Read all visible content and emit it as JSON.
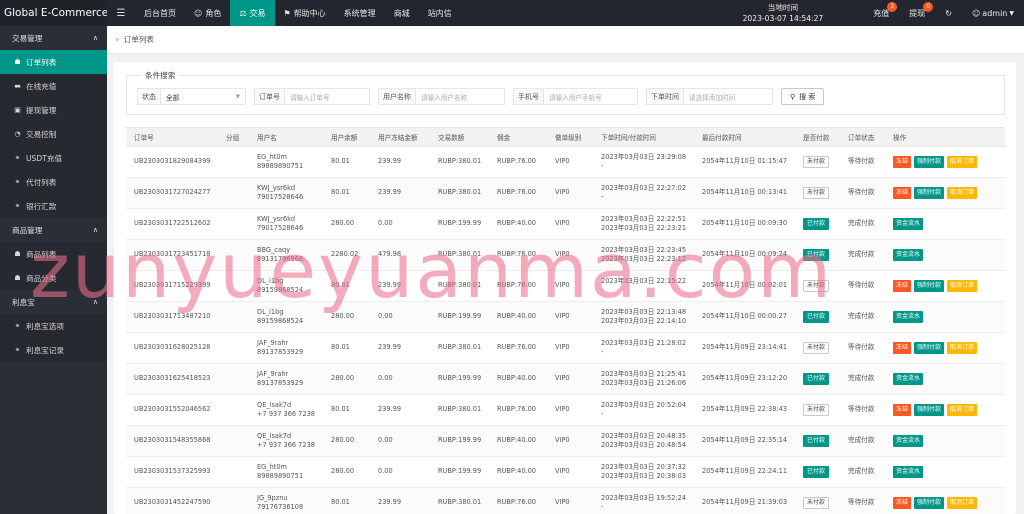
{
  "app": {
    "title": "Global E-Commerce..."
  },
  "topnav": [
    {
      "label": "后台首页",
      "icon": "home-icon",
      "active": false
    },
    {
      "label": "角色",
      "icon": "user-icon",
      "active": false
    },
    {
      "label": "交易",
      "icon": "scale-icon",
      "active": true
    },
    {
      "label": "帮助中心",
      "icon": "flag-icon",
      "active": false
    },
    {
      "label": "系统管理",
      "icon": "",
      "active": false
    },
    {
      "label": "商城",
      "icon": "",
      "active": false
    },
    {
      "label": "站内信",
      "icon": "",
      "active": false
    }
  ],
  "clock": {
    "label": "当地时间",
    "value": "2023-03-07 14:54:27"
  },
  "topright": {
    "recharge": {
      "label": "充值",
      "badge": "2"
    },
    "withdraw": {
      "label": "提现",
      "badge": "0"
    },
    "user": "admin"
  },
  "sidebar": {
    "group1": "交易管理",
    "group1_items": [
      {
        "label": "订单列表",
        "icon": "cart-icon",
        "active": true
      },
      {
        "label": "在线充值",
        "icon": "card-icon",
        "active": false
      },
      {
        "label": "提现管理",
        "icon": "wallet-icon",
        "active": false
      },
      {
        "label": "交易控制",
        "icon": "gauge-icon",
        "active": false
      },
      {
        "label": "USDT充值",
        "icon": "link-icon",
        "active": false
      },
      {
        "label": "代付列表",
        "icon": "link-icon",
        "active": false
      },
      {
        "label": "银行汇款",
        "icon": "link-icon",
        "active": false
      }
    ],
    "group2": "商品管理",
    "group2_items": [
      {
        "label": "商品列表",
        "icon": "cart-icon",
        "active": false
      },
      {
        "label": "商品分类",
        "icon": "cart-icon",
        "active": false
      }
    ],
    "group3": "利息宝",
    "group3_items": [
      {
        "label": "利息宝选项",
        "icon": "link-icon",
        "active": false
      },
      {
        "label": "利息宝记录",
        "icon": "link-icon",
        "active": false
      }
    ]
  },
  "breadcrumb": "订单列表",
  "filters": {
    "legend": "条件搜索",
    "status_label": "状态",
    "status_value": "全部",
    "order_label": "订单号",
    "order_placeholder": "请输入订单号",
    "username_label": "用户名称",
    "username_placeholder": "请输入用户名称",
    "phone_label": "手机号",
    "phone_placeholder": "请输入用户手机号",
    "time_label": "下单时间",
    "time_placeholder": "请选择添加时间",
    "search_button": "搜 索"
  },
  "table": {
    "headers": [
      "订单号",
      "分组",
      "用户名",
      "用户余额",
      "用户冻结金额",
      "交易数额",
      "佣金",
      "做单级别",
      "下单时间/付款时间",
      "最后付款时间",
      "是否付款",
      "订单状态",
      "操作"
    ],
    "rows": [
      {
        "order": "UB2303031829084399",
        "group": "",
        "user": "EG_ht0m",
        "phone": "89889890751",
        "balance": "80.01",
        "frozen": "239.99",
        "amount": "RUBP:380.01",
        "commission": "RUBP:76.00",
        "level": "VIP0",
        "t1": "2023年03月03日 23:29:08",
        "t2": "-",
        "last": "2054年11月10日 01:15:47",
        "pay": "未付款",
        "paid": false,
        "status": "等待付款"
      },
      {
        "order": "UB2303031727024277",
        "group": "",
        "user": "KWJ_ysr6kd",
        "phone": "79017528646",
        "balance": "80.01",
        "frozen": "239.99",
        "amount": "RUBP:380.01",
        "commission": "RUBP:76.00",
        "level": "VIP0",
        "t1": "2023年03月03日 22:27:02",
        "t2": "-",
        "last": "2054年11月10日 00:13:41",
        "pay": "未付款",
        "paid": false,
        "status": "等待付款"
      },
      {
        "order": "UB2303031722512602",
        "group": "",
        "user": "KWJ_ysr6kd",
        "phone": "79017528646",
        "balance": "280.00",
        "frozen": "0.00",
        "amount": "RUBP:199.99",
        "commission": "RUBP:40.00",
        "level": "VIP0",
        "t1": "2023年03月03日 22:22:51",
        "t2": "2023年03月03日 22:23:21",
        "last": "2054年11月10日 00:09:30",
        "pay": "已付款",
        "paid": true,
        "status": "完成付款"
      },
      {
        "order": "UB2303031723451718",
        "group": "",
        "user": "BBG_caqy",
        "phone": "89131796966",
        "balance": "2280.02",
        "frozen": "479.98",
        "amount": "RUBP:380.01",
        "commission": "RUBP:76.00",
        "level": "VIP0",
        "t1": "2023年03月03日 22:23:45",
        "t2": "2023年03月03日 22:23:12",
        "last": "2054年11月10日 00:09:24",
        "pay": "已付款",
        "paid": true,
        "status": "完成付款"
      },
      {
        "order": "UB2303031715229399",
        "group": "",
        "user": "DL_i1bg",
        "phone": "89159868524",
        "balance": "80.01",
        "frozen": "239.99",
        "amount": "RUBP:380.01",
        "commission": "RUBP:76.00",
        "level": "VIP0",
        "t1": "2023年03月03日 22:15:22",
        "t2": "-",
        "last": "2054年11月10日 00:02:01",
        "pay": "未付款",
        "paid": false,
        "status": "等待付款"
      },
      {
        "order": "UB2303031713487210",
        "group": "",
        "user": "DL_i1bg",
        "phone": "89159868524",
        "balance": "280.00",
        "frozen": "0.00",
        "amount": "RUBP:199.99",
        "commission": "RUBP:40.00",
        "level": "VIP0",
        "t1": "2023年03月03日 22:13:48",
        "t2": "2023年03月03日 22:14:10",
        "last": "2054年11月10日 00:00:27",
        "pay": "已付款",
        "paid": true,
        "status": "完成付款"
      },
      {
        "order": "UB2303031628025128",
        "group": "",
        "user": "JAF_9rahr",
        "phone": "89137853929",
        "balance": "80.01",
        "frozen": "239.99",
        "amount": "RUBP:380.01",
        "commission": "RUBP:76.00",
        "level": "VIP0",
        "t1": "2023年03月03日 21:28:02",
        "t2": "-",
        "last": "2054年11月09日 23:14:41",
        "pay": "未付款",
        "paid": false,
        "status": "等待付款"
      },
      {
        "order": "UB2303031625418523",
        "group": "",
        "user": "JAF_9rahr",
        "phone": "89137853929",
        "balance": "280.00",
        "frozen": "0.00",
        "amount": "RUBP:199.99",
        "commission": "RUBP:40.00",
        "level": "VIP0",
        "t1": "2023年03月03日 21:25:41",
        "t2": "2023年03月03日 21:26:06",
        "last": "2054年11月09日 23:12:20",
        "pay": "已付款",
        "paid": true,
        "status": "完成付款"
      },
      {
        "order": "UB2303031552046562",
        "group": "",
        "user": "QE_lsak7d",
        "phone": "+7 937 366 7238",
        "balance": "80.01",
        "frozen": "239.99",
        "amount": "RUBP:380.01",
        "commission": "RUBP:76.00",
        "level": "VIP0",
        "t1": "2023年03月03日 20:52:04",
        "t2": "-",
        "last": "2054年11月09日 22:38:43",
        "pay": "未付款",
        "paid": false,
        "status": "等待付款"
      },
      {
        "order": "UB2303031548355868",
        "group": "",
        "user": "QE_lsak7d",
        "phone": "+7 937 366 7238",
        "balance": "280.00",
        "frozen": "0.00",
        "amount": "RUBP:199.99",
        "commission": "RUBP:40.00",
        "level": "VIP0",
        "t1": "2023年03月03日 20:48:35",
        "t2": "2023年03月03日 20:48:54",
        "last": "2054年11月09日 22:35:14",
        "pay": "已付款",
        "paid": true,
        "status": "完成付款"
      },
      {
        "order": "UB2303031537325993",
        "group": "",
        "user": "EG_ht0m",
        "phone": "89889890751",
        "balance": "280.00",
        "frozen": "0.00",
        "amount": "RUBP:199.99",
        "commission": "RUBP:40.00",
        "level": "VIP0",
        "t1": "2023年03月03日 20:37:32",
        "t2": "2023年03月03日 20:38:03",
        "last": "2054年11月09日 22:24:11",
        "pay": "已付款",
        "paid": true,
        "status": "完成付款"
      },
      {
        "order": "UB2303031452247590",
        "group": "",
        "user": "JG_9pznu",
        "phone": "79176736108",
        "balance": "80.01",
        "frozen": "239.99",
        "amount": "RUBP:380.01",
        "commission": "RUBP:76.00",
        "level": "VIP0",
        "t1": "2023年03月03日 19:52:24",
        "t2": "-",
        "last": "2054年11月09日 21:39:03",
        "pay": "未付款",
        "paid": false,
        "status": "等待付款"
      }
    ],
    "actions_unpaid": [
      "冻结",
      "强制付款",
      "取消订单"
    ],
    "action_paid": "资金流水"
  },
  "watermark": "zunyueyuanma.com"
}
